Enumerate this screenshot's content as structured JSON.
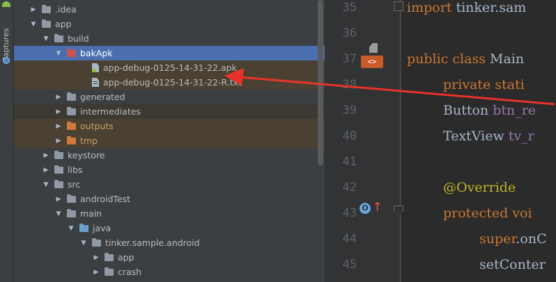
{
  "toolstrip": {
    "captures_label": "Captures"
  },
  "tree": {
    "rows": [
      {
        "label": ".idea",
        "arrow": "▶",
        "icon": "folder"
      },
      {
        "label": "app",
        "arrow": "▼",
        "icon": "folder"
      },
      {
        "label": "build",
        "arrow": "▼",
        "icon": "folder"
      },
      {
        "label": "bakApk",
        "arrow": "▼",
        "icon": "folder-red"
      },
      {
        "label": "app-debug-0125-14-31-22.apk",
        "icon": "apk-file"
      },
      {
        "label": "app-debug-0125-14-31-22-R.txt",
        "icon": "text-file"
      },
      {
        "label": "generated",
        "arrow": "▶",
        "icon": "folder"
      },
      {
        "label": "intermediates",
        "arrow": "▶",
        "icon": "folder"
      },
      {
        "label": "outputs",
        "arrow": "▶",
        "icon": "folder-orange"
      },
      {
        "label": "tmp",
        "arrow": "▶",
        "icon": "folder-orange"
      },
      {
        "label": "keystore",
        "arrow": "▶",
        "icon": "folder"
      },
      {
        "label": "libs",
        "arrow": "▶",
        "icon": "folder"
      },
      {
        "label": "src",
        "arrow": "▼",
        "icon": "folder"
      },
      {
        "label": "androidTest",
        "arrow": "▶",
        "icon": "folder"
      },
      {
        "label": "main",
        "arrow": "▼",
        "icon": "folder"
      },
      {
        "label": "java",
        "arrow": "▼",
        "icon": "folder-blue"
      },
      {
        "label": "tinker.sample.android",
        "arrow": "▼",
        "icon": "package"
      },
      {
        "label": "app",
        "arrow": "▶",
        "icon": "package"
      },
      {
        "label": "crash",
        "arrow": "▶",
        "icon": "package"
      }
    ]
  },
  "editor": {
    "line_numbers": [
      "35",
      "36",
      "37",
      "38",
      "39",
      "40",
      "41",
      "42",
      "43",
      "44",
      "45"
    ],
    "lines": [
      {
        "kw": "import",
        "rest": " tinker.sam"
      },
      {
        "kw": "",
        "rest": ""
      },
      {
        "kw": "public class",
        "rest": " Main"
      },
      {
        "kw": "private stati",
        "rest": ""
      },
      {
        "kw": "",
        "rest": "Button ",
        "field": "btn_re"
      },
      {
        "kw": "",
        "rest": "TextView ",
        "field": "tv_r"
      },
      {
        "kw": "",
        "rest": ""
      },
      {
        "kw": "",
        "ann": "@Override"
      },
      {
        "kw": "protected voi",
        "rest": ""
      },
      {
        "kw": "super",
        "rest": ".onC"
      },
      {
        "kw": "",
        "rest": "setConter"
      }
    ],
    "gutter_tag": "<>",
    "override_marker": "O"
  }
}
